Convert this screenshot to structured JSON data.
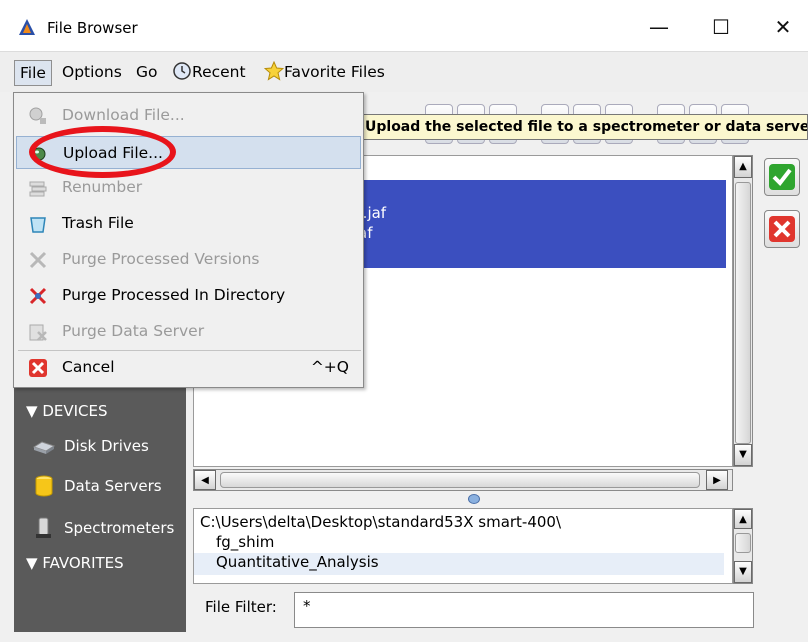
{
  "window": {
    "title": "File Browser",
    "minimize": "—",
    "maximize": "☐",
    "close": "✕"
  },
  "menubar": {
    "file": "File",
    "options": "Options",
    "go": "Go",
    "recent": "Recent",
    "favorites": "Favorite Files"
  },
  "tooltip": "Upload the selected file to a spectrometer or data server",
  "file_menu": {
    "download": "Download File...",
    "upload": "Upload File...",
    "renumber": "Renumber",
    "trash": "Trash File",
    "purge_versions": "Purge Processed Versions",
    "purge_directory": "Purge Processed In Directory",
    "purge_server": "Purge Data Server",
    "cancel": "Cancel",
    "cancel_shortcut": "^+Q"
  },
  "file_list": {
    "row1": "ysis.jaf",
    "row2": "af"
  },
  "sidebar": {
    "devices_header": "DEVICES",
    "disk_drives": "Disk Drives",
    "data_servers": "Data Servers",
    "spectrometers": "Spectrometers",
    "favorites_header": "FAVORITES"
  },
  "path": {
    "line1": "C:\\Users\\delta\\Desktop\\standard53X smart-400\\",
    "line2": "fg_shim",
    "line3": "Quantitative_Analysis"
  },
  "filter": {
    "label": "File Filter:",
    "value": "*"
  },
  "colors": {
    "selection": "#3b4fbf",
    "sidebar": "#5a5a5a",
    "highlight_ellipse": "#e8141b",
    "tooltip_bg": "#fbf7cf"
  }
}
